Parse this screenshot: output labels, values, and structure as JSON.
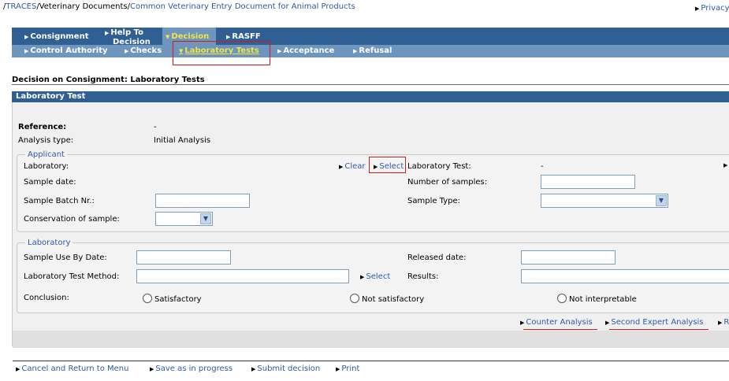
{
  "breadcrumb": {
    "items": [
      "TRACES",
      "Veterinary Documents",
      "Common Veterinary Entry Document for Animal Products"
    ],
    "separator": "/",
    "lead": "/",
    "privacy": "Privacy"
  },
  "nav_top": [
    "Consignment",
    "Help To",
    "Decision",
    "Decision",
    "RASFF"
  ],
  "nav_sub": [
    "Control Authority",
    "Checks",
    "Laboratory Tests",
    "Acceptance",
    "Refusal"
  ],
  "page": {
    "title": "Decision on Consignment: Laboratory Tests",
    "section": "Laboratory Test"
  },
  "info": {
    "reference_label": "Reference:",
    "reference_value": "-",
    "analysis_label": "Analysis type:",
    "analysis_value": "Initial Analysis"
  },
  "applicant": {
    "legend": "Applicant",
    "laboratory_label": "Laboratory:",
    "clear": "Clear",
    "select": "Select",
    "lab_test_label": "Laboratory Test:",
    "lab_test_value": "-",
    "sample_date_label": "Sample date:",
    "num_samples_label": "Number of samples:",
    "batch_label": "Sample Batch Nr.:",
    "sample_type_label": "Sample Type:",
    "conservation_label": "Conservation of sample:"
  },
  "laboratory": {
    "legend": "Laboratory",
    "use_by_label": "Sample Use By Date:",
    "released_label": "Released date:",
    "method_label": "Laboratory Test Method:",
    "method_select": "Select",
    "results_label": "Results:",
    "conclusion_label": "Conclusion:",
    "conclusion_options": [
      "Satisfactory",
      "Not satisfactory",
      "Not interpretable"
    ]
  },
  "analysis_links": [
    "Counter Analysis",
    "Second Expert Analysis",
    "R"
  ],
  "footer_links": [
    "Cancel and Return to Menu",
    "Save as in progress",
    "Submit decision",
    "Print"
  ],
  "colors": {
    "nav_dark": "#2f5f93",
    "nav_light": "#6d95bd",
    "active": "#f3e640",
    "highlight": "#d21a1a",
    "link": "#2e5aa8"
  }
}
